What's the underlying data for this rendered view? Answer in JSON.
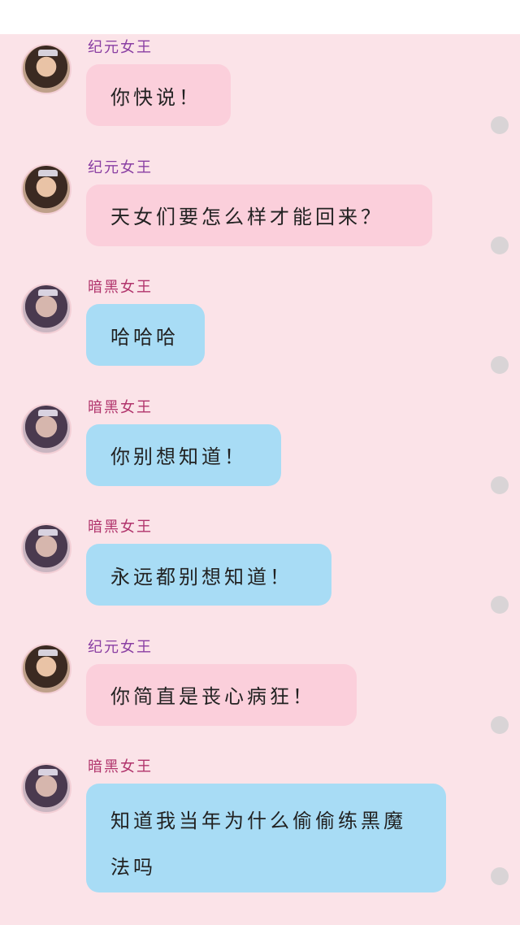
{
  "messages": [
    {
      "sender": "纪元女王",
      "text": "你快说！",
      "style": "pink"
    },
    {
      "sender": "纪元女王",
      "text": "天女们要怎么样才能回来？",
      "style": "pink"
    },
    {
      "sender": "暗黑女王",
      "text": "哈哈哈",
      "style": "blue"
    },
    {
      "sender": "暗黑女王",
      "text": "你别想知道！",
      "style": "blue"
    },
    {
      "sender": "暗黑女王",
      "text": "永远都别想知道！",
      "style": "blue"
    },
    {
      "sender": "纪元女王",
      "text": "你简直是丧心病狂！",
      "style": "pink"
    },
    {
      "sender": "暗黑女王",
      "text": "知道我当年为什么偷偷练黑魔法吗",
      "style": "blue"
    }
  ],
  "colors": {
    "background": "#fbe3e8",
    "pink_bubble": "#fbcfdb",
    "blue_bubble": "#a8dcf5",
    "ji_name": "#8a3fa3",
    "an_name": "#b1346c"
  }
}
